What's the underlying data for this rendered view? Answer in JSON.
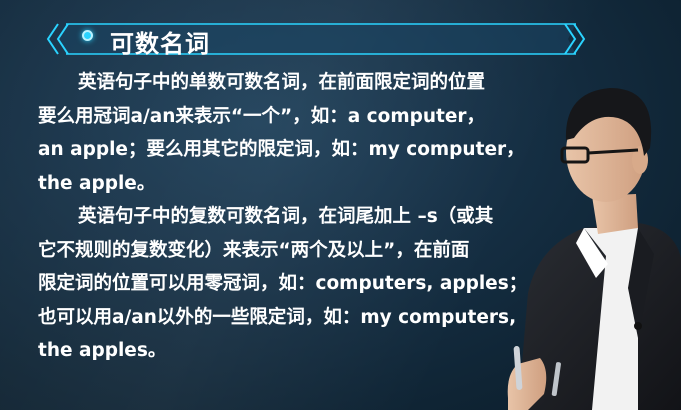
{
  "title": {
    "text": "可数名词"
  },
  "paragraphs": [
    {
      "lines": [
        "英语句子中的单数可数名词，在前面限定词的位置",
        "要么用冠词a/an来表示“一个”，如：a  computer，",
        "an  apple；要么用其它的限定词，如：my  computer，",
        "the apple。"
      ]
    },
    {
      "lines": [
        "英语句子中的复数可数名词，在词尾加上 –s（或其",
        "它不规则的复数变化）来表示“两个及以上”，在前面",
        "限定词的位置可以用零冠词，如：computers, apples；",
        "也可以用a/an以外的一些限定词，如：my computers,",
        "the apples。"
      ]
    }
  ],
  "colors": {
    "background": "#173248",
    "banner_line": "#2ad3ff",
    "text": "#ffffff"
  },
  "icons": {
    "title_bullet": "glowing-dot-icon",
    "banner_left": "double-chevron-left-icon",
    "banner_right": "double-chevron-right-icon"
  }
}
